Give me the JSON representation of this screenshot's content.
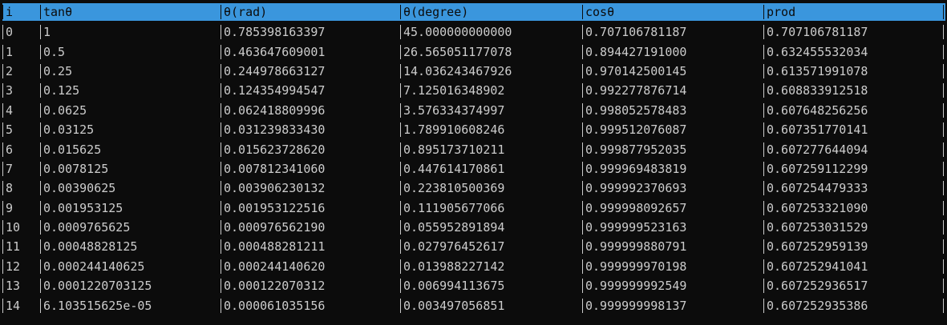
{
  "table": {
    "columns": [
      "i",
      "tanθ",
      "θ(rad)",
      "θ(degree)",
      "cosθ",
      "prod"
    ],
    "rows": [
      [
        "0",
        "1",
        "0.785398163397",
        "45.000000000000",
        "0.707106781187",
        "0.707106781187"
      ],
      [
        "1",
        "0.5",
        "0.463647609001",
        "26.565051177078",
        "0.894427191000",
        "0.632455532034"
      ],
      [
        "2",
        "0.25",
        "0.244978663127",
        "14.036243467926",
        "0.970142500145",
        "0.613571991078"
      ],
      [
        "3",
        "0.125",
        "0.124354994547",
        "7.125016348902",
        "0.992277876714",
        "0.608833912518"
      ],
      [
        "4",
        "0.0625",
        "0.062418809996",
        "3.576334374997",
        "0.998052578483",
        "0.607648256256"
      ],
      [
        "5",
        "0.03125",
        "0.031239833430",
        "1.789910608246",
        "0.999512076087",
        "0.607351770141"
      ],
      [
        "6",
        "0.015625",
        "0.015623728620",
        "0.895173710211",
        "0.999877952035",
        "0.607277644094"
      ],
      [
        "7",
        "0.0078125",
        "0.007812341060",
        "0.447614170861",
        "0.999969483819",
        "0.607259112299"
      ],
      [
        "8",
        "0.00390625",
        "0.003906230132",
        "0.223810500369",
        "0.999992370693",
        "0.607254479333"
      ],
      [
        "9",
        "0.001953125",
        "0.001953122516",
        "0.111905677066",
        "0.999998092657",
        "0.607253321090"
      ],
      [
        "10",
        "0.0009765625",
        "0.000976562190",
        "0.055952891894",
        "0.999999523163",
        "0.607253031529"
      ],
      [
        "11",
        "0.00048828125",
        "0.000488281211",
        "0.027976452617",
        "0.999999880791",
        "0.607252959139"
      ],
      [
        "12",
        "0.000244140625",
        "0.000244140620",
        "0.013988227142",
        "0.999999970198",
        "0.607252941041"
      ],
      [
        "13",
        "0.0001220703125",
        "0.000122070312",
        "0.006994113675",
        "0.999999992549",
        "0.607252936517"
      ],
      [
        "14",
        "6.103515625e-05",
        "0.000061035156",
        "0.003497056851",
        "0.999999998137",
        "0.607252935386"
      ]
    ]
  },
  "colors": {
    "background": "#0c0c0c",
    "text": "#cccccc",
    "header_background": "#3a96dd",
    "header_text": "#0c0c0c"
  }
}
